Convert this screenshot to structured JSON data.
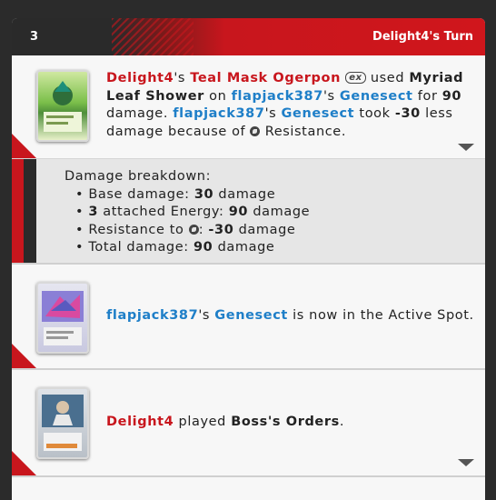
{
  "header": {
    "turn_number": "3",
    "turn_label": "Delight4's Turn"
  },
  "entry1": {
    "player": "Delight4",
    "possessive": "'s ",
    "pokemon": "Teal Mask Ogerpon",
    "ex_mark": "ex",
    "used": " used ",
    "move": "Myriad Leaf Shower",
    "on": " on ",
    "opponent": "flapjack387",
    "possessive2": "'s ",
    "target": "Genesect",
    "for": " for ",
    "damage": "90",
    "damage_word": " damage. ",
    "opponent2": "flapjack387",
    "possessive3": "'s ",
    "target2": "Genesect",
    "took": " took ",
    "reduction": "-30",
    "less": " less damage because of ",
    "resistance": " Resistance."
  },
  "breakdown": {
    "title": "Damage breakdown:",
    "base_label": "• Base damage: ",
    "base_value": "30",
    "base_unit": " damage",
    "energy_count": "3",
    "energy_label": " attached Energy: ",
    "energy_value": "90",
    "energy_unit": " damage",
    "resist_label": "• Resistance to ",
    "resist_value": "-30",
    "resist_unit": " damage",
    "total_label": "• Total damage: ",
    "total_value": "90",
    "total_unit": " damage",
    "bullet": "• "
  },
  "entry2": {
    "opponent": "flapjack387",
    "possessive": "'s ",
    "pokemon": "Genesect",
    "text": " is now in the Active Spot."
  },
  "entry3": {
    "player": "Delight4",
    "text": " played ",
    "card": "Boss's Orders",
    "end": "."
  },
  "colors": {
    "accent": "#c8161d",
    "opponent": "#1f7fc8"
  }
}
